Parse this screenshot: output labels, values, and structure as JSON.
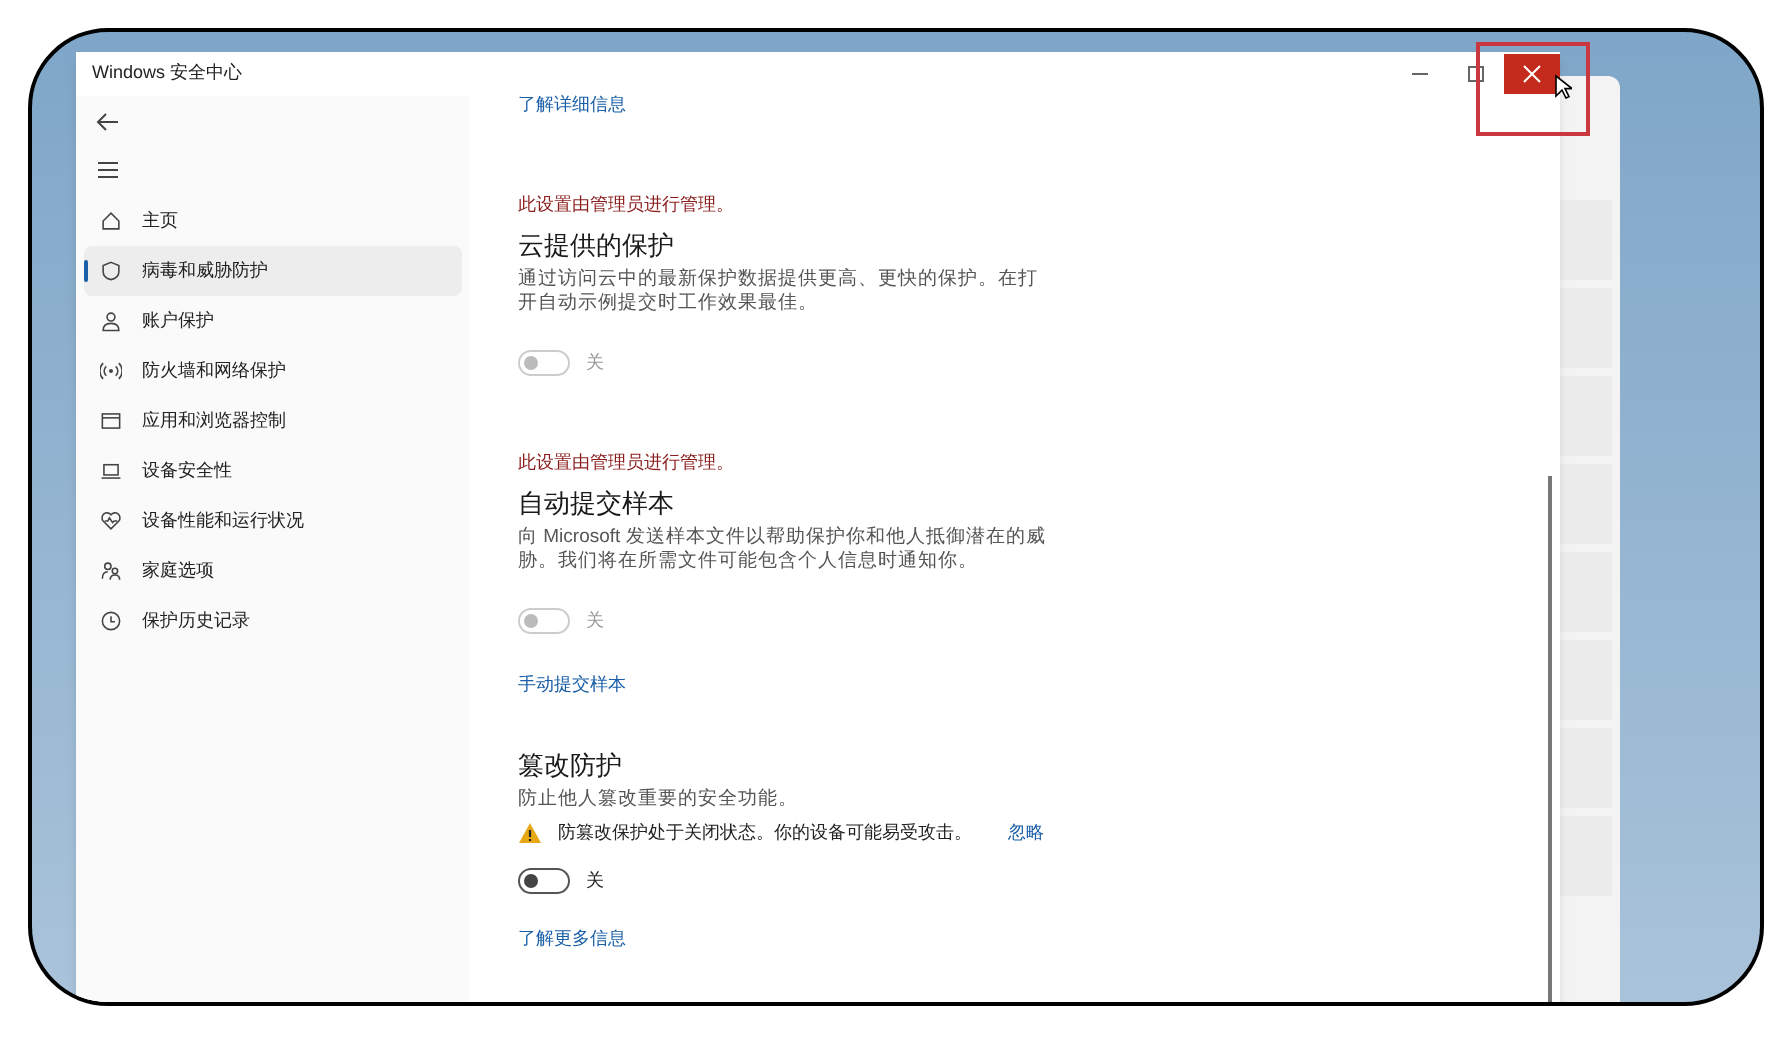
{
  "window": {
    "title": "Windows 安全中心"
  },
  "sidebar": {
    "items": [
      {
        "label": "主页",
        "selected": false
      },
      {
        "label": "病毒和威胁防护",
        "selected": true
      },
      {
        "label": "账户保护",
        "selected": false
      },
      {
        "label": "防火墙和网络保护",
        "selected": false
      },
      {
        "label": "应用和浏览器控制",
        "selected": false
      },
      {
        "label": "设备安全性",
        "selected": false
      },
      {
        "label": "设备性能和运行状况",
        "selected": false
      },
      {
        "label": "家庭选项",
        "selected": false
      },
      {
        "label": "保护历史记录",
        "selected": false
      }
    ]
  },
  "top_link": "了解详细信息",
  "sections": [
    {
      "admin_notice": "此设置由管理员进行管理。",
      "title": "云提供的保护",
      "description": "通过访问云中的最新保护数据提供更高、更快的保护。在打开自动示例提交时工作效果最佳。",
      "toggle": {
        "on": false,
        "disabled": true,
        "label": "关"
      }
    },
    {
      "admin_notice": "此设置由管理员进行管理。",
      "title": "自动提交样本",
      "description": "向 Microsoft 发送样本文件以帮助保护你和他人抵御潜在的威胁。我们将在所需文件可能包含个人信息时通知你。",
      "toggle": {
        "on": false,
        "disabled": true,
        "label": "关"
      },
      "link": "手动提交样本"
    },
    {
      "title": "篡改防护",
      "description": "防止他人篡改重要的安全功能。",
      "warning": {
        "text": "防篡改保护处于关闭状态。你的设备可能易受攻击。",
        "action": "忽略"
      },
      "toggle": {
        "on": false,
        "disabled": false,
        "label": "关"
      },
      "link": "了解更多信息"
    }
  ]
}
